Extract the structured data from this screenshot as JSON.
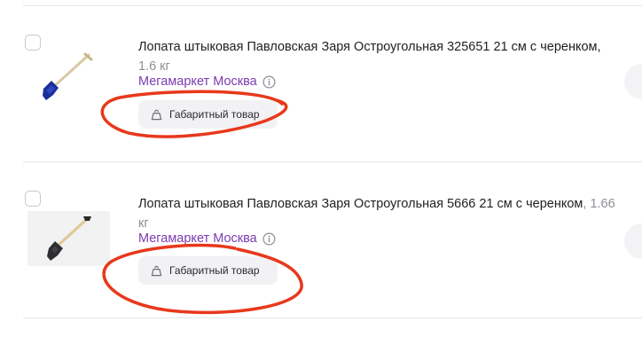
{
  "items": [
    {
      "title": "Лопата штыковая Павловская Заря Остроугольная 325651 21 см с черенком",
      "weight": "1.6 кг",
      "seller": "Мегамаркет Москва",
      "badge": "Габаритный товар"
    },
    {
      "title": "Лопата штыковая Павловская Заря Остроугольная 5666 21 см с черенком",
      "weight": "1.66 кг",
      "seller": "Мегамаркет Москва",
      "badge": "Габаритный товар"
    }
  ],
  "colors": {
    "seller": "#7b3bb1",
    "annotation": "#e8381c",
    "badge_bg": "#f2f2f5"
  }
}
